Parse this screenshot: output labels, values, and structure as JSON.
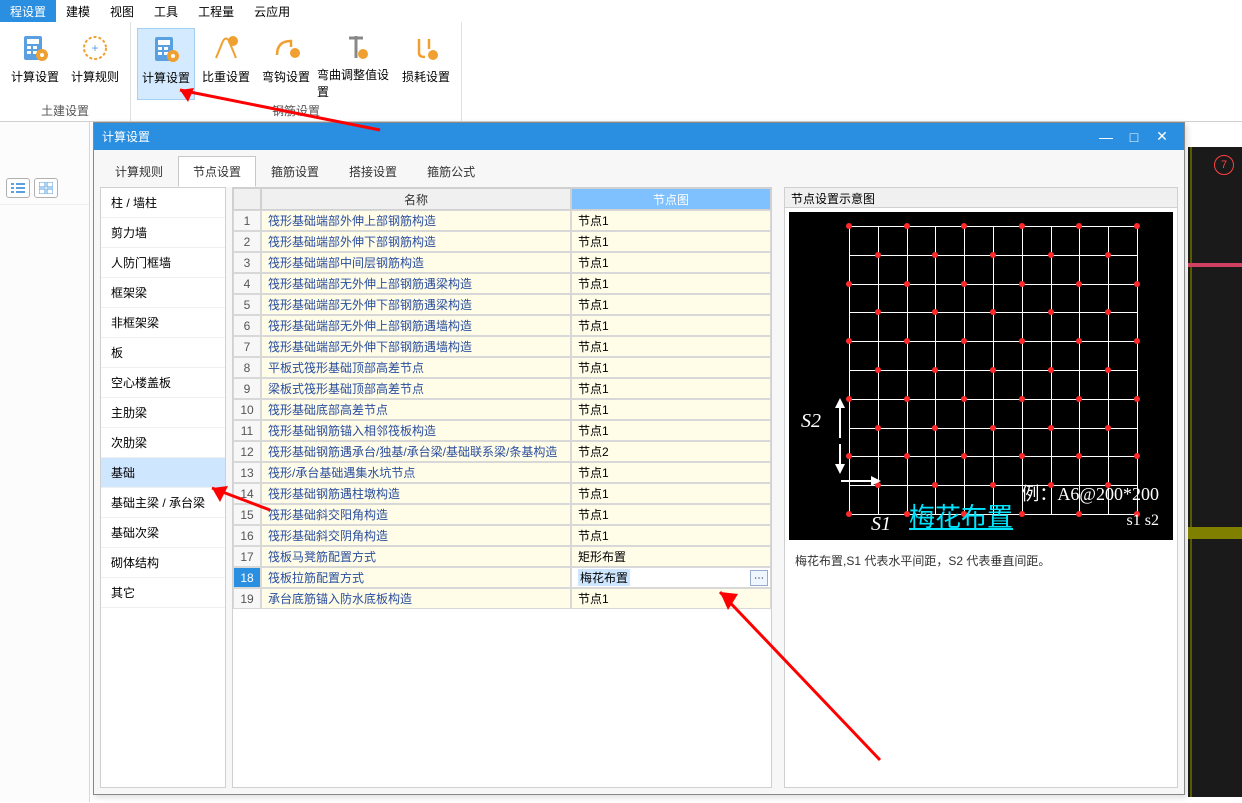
{
  "menu": {
    "items": [
      "程设置",
      "建模",
      "视图",
      "工具",
      "工程量",
      "云应用"
    ],
    "active": 0
  },
  "ribbon": {
    "groups": [
      {
        "title": "土建设置",
        "buttons": [
          {
            "label": "计算设置"
          },
          {
            "label": "计算规则"
          }
        ]
      },
      {
        "title": "钢筋设置",
        "buttons": [
          {
            "label": "计算设置",
            "active": true
          },
          {
            "label": "比重设置"
          },
          {
            "label": "弯钩设置"
          },
          {
            "label": "弯曲调整值设置",
            "wide": true
          },
          {
            "label": "损耗设置"
          }
        ]
      }
    ]
  },
  "dialog": {
    "title": "计算设置",
    "tabs": [
      "计算规则",
      "节点设置",
      "箍筋设置",
      "搭接设置",
      "箍筋公式"
    ],
    "active_tab": 1,
    "sidebar": [
      "柱 / 墙柱",
      "剪力墙",
      "人防门框墙",
      "框架梁",
      "非框架梁",
      "板",
      "空心楼盖板",
      "主肋梁",
      "次肋梁",
      "基础",
      "基础主梁 / 承台梁",
      "基础次梁",
      "砌体结构",
      "其它"
    ],
    "sidebar_active": 9,
    "columns": {
      "name": "名称",
      "node": "节点图"
    },
    "rows": [
      {
        "n": 1,
        "name": "筏形基础端部外伸上部钢筋构造",
        "node": "节点1"
      },
      {
        "n": 2,
        "name": "筏形基础端部外伸下部钢筋构造",
        "node": "节点1"
      },
      {
        "n": 3,
        "name": "筏形基础端部中间层钢筋构造",
        "node": "节点1"
      },
      {
        "n": 4,
        "name": "筏形基础端部无外伸上部钢筋遇梁构造",
        "node": "节点1"
      },
      {
        "n": 5,
        "name": "筏形基础端部无外伸下部钢筋遇梁构造",
        "node": "节点1"
      },
      {
        "n": 6,
        "name": "筏形基础端部无外伸上部钢筋遇墙构造",
        "node": "节点1"
      },
      {
        "n": 7,
        "name": "筏形基础端部无外伸下部钢筋遇墙构造",
        "node": "节点1"
      },
      {
        "n": 8,
        "name": "平板式筏形基础顶部高差节点",
        "node": "节点1"
      },
      {
        "n": 9,
        "name": "梁板式筏形基础顶部高差节点",
        "node": "节点1"
      },
      {
        "n": 10,
        "name": "筏形基础底部高差节点",
        "node": "节点1"
      },
      {
        "n": 11,
        "name": "筏形基础钢筋锚入相邻筏板构造",
        "node": "节点1"
      },
      {
        "n": 12,
        "name": "筏形基础钢筋遇承台/独基/承台梁/基础联系梁/条基构造",
        "node": "节点2"
      },
      {
        "n": 13,
        "name": "筏形/承台基础遇集水坑节点",
        "node": "节点1"
      },
      {
        "n": 14,
        "name": "筏形基础钢筋遇柱墩构造",
        "node": "节点1"
      },
      {
        "n": 15,
        "name": "筏形基础斜交阳角构造",
        "node": "节点1"
      },
      {
        "n": 16,
        "name": "筏形基础斜交阴角构造",
        "node": "节点1"
      },
      {
        "n": 17,
        "name": "筏板马凳筋配置方式",
        "node": "矩形布置"
      },
      {
        "n": 18,
        "name": "筏板拉筋配置方式",
        "node": "梅花布置",
        "sel": true
      },
      {
        "n": 19,
        "name": "承台底筋锚入防水底板构造",
        "node": "节点1"
      }
    ],
    "preview": {
      "title": "节点设置示意图",
      "s1": "S1",
      "s2": "S2",
      "example": "例：A6@200*200",
      "s1s2": "s1   s2",
      "link": "梅花布置",
      "desc": "梅花布置,S1 代表水平间距，S2 代表垂直间距。"
    }
  },
  "cad_badge": "7"
}
